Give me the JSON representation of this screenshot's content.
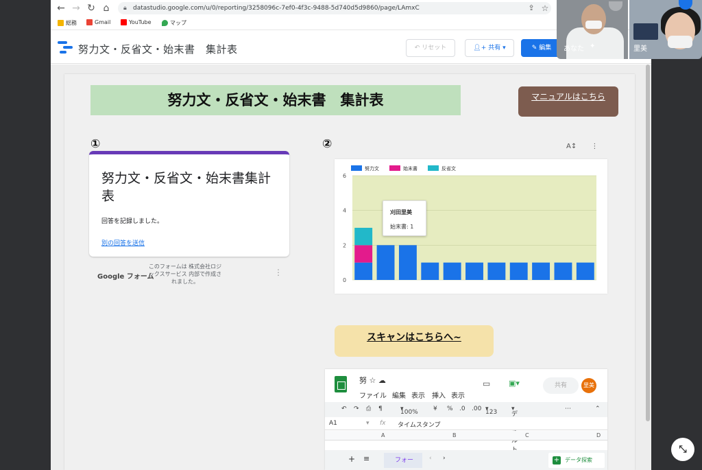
{
  "browser": {
    "url": "datastudio.google.com/u/0/reporting/3258096c-7ef0-4f3c-9488-5d740d5d9860/page/LAmxC",
    "bookmarks": [
      {
        "label": "総務",
        "color": "#f4b400"
      },
      {
        "label": "Gmail",
        "color": "#ea4335"
      },
      {
        "label": "YouTube",
        "color": "#ff0000"
      },
      {
        "label": "マップ",
        "color": "#34a853"
      }
    ]
  },
  "header": {
    "report_title": "努力文・反省文・始末書　集計表",
    "reset_label": "リセット",
    "share_label": "共有",
    "edit_label": "編集"
  },
  "page": {
    "banner_title": "努力文・反省文・始末書　集計表",
    "manual_link": "マニュアルはこちら",
    "label_1": "①",
    "label_2": "②",
    "scan_banner": "スキャンはこちらへ~"
  },
  "form": {
    "title": "努力文・反省文・始末書集計表",
    "message": "回答を記録しました。",
    "link": "別の回答を送信",
    "footer_brand": "Google フォーム",
    "footer_text": "このフォームは 株式会社ロジックスサービス 内部で作成されました。"
  },
  "chart_data": {
    "type": "bar",
    "stacked": true,
    "series": [
      {
        "name": "努力文",
        "color": "#1a73e8",
        "values": [
          1,
          2,
          2,
          1,
          1,
          1,
          1,
          1,
          1,
          1,
          1
        ]
      },
      {
        "name": "始末書",
        "color": "#e31b8c",
        "values": [
          1,
          0,
          0,
          0,
          0,
          0,
          0,
          0,
          0,
          0,
          0
        ]
      },
      {
        "name": "反省文",
        "color": "#22b8c9",
        "values": [
          1,
          0,
          0,
          0,
          0,
          0,
          0,
          0,
          0,
          0,
          0
        ]
      }
    ],
    "ylim": [
      0,
      6
    ],
    "yticks": [
      "0",
      "2",
      "4",
      "6"
    ],
    "legend_position": "top-left",
    "tooltip": {
      "name": "刈田里美",
      "value_line": "始末書: 1"
    }
  },
  "sheet": {
    "name": "努",
    "menu": [
      "ファイル",
      "編集",
      "表示",
      "挿入",
      "表示"
    ],
    "share_label": "共有",
    "avatar": "里美",
    "zoom": "100%",
    "currency": "¥",
    "percent": "%",
    "dec_less": ".0",
    "dec_more": ".00",
    "num_format": "123",
    "font": "デフォルト...",
    "cell_ref": "A1",
    "fx": "fx",
    "formula": "タイムスタンプ",
    "columns": [
      "A",
      "B",
      "C",
      "D"
    ],
    "tab_label": "フォー",
    "explore_label": "データ探索"
  },
  "meet": {
    "self_label": "あなた",
    "other_label": "里美"
  }
}
